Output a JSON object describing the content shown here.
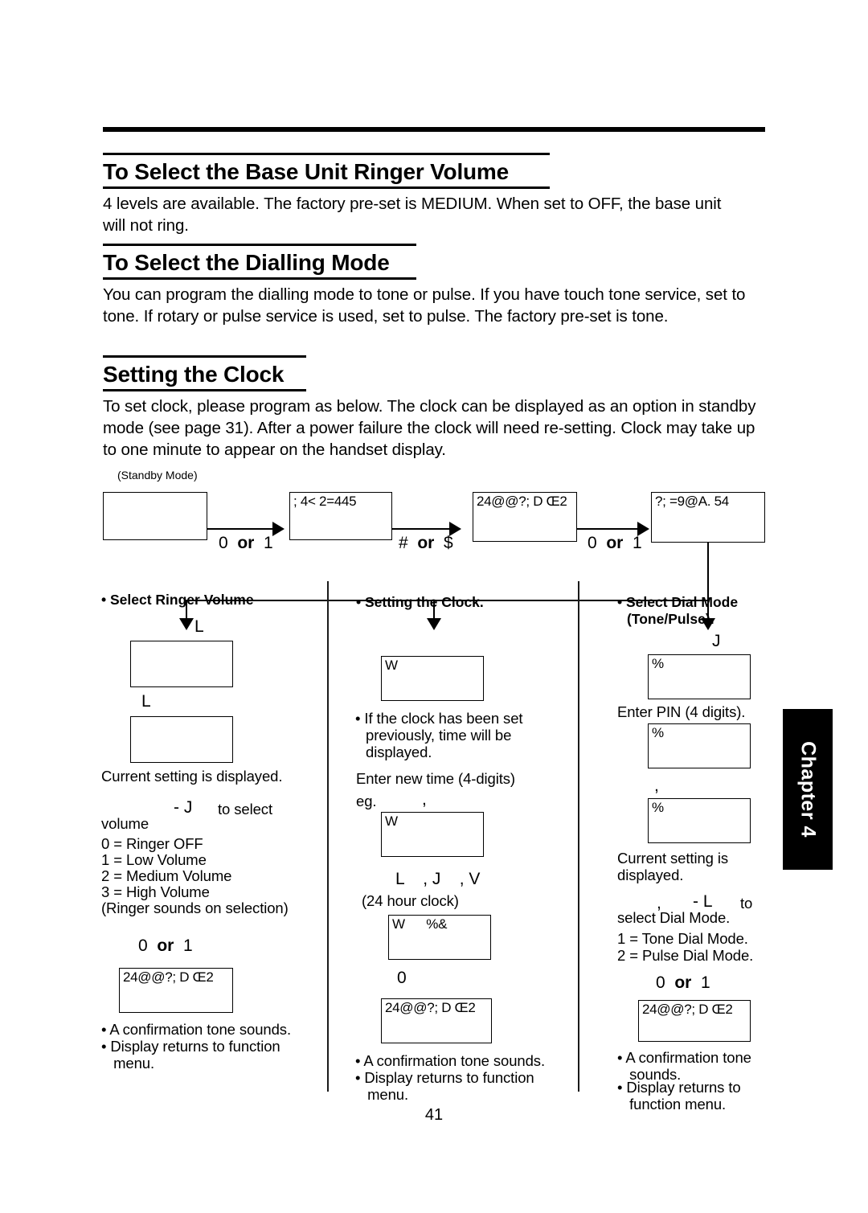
{
  "page": {
    "number": "41",
    "chapter_tab": "Chapter 4"
  },
  "sections": [
    {
      "heading": "To Select the Base Unit Ringer Volume",
      "body": "4 levels are available. The factory pre-set is MEDIUM. When set to OFF, the base unit will not ring."
    },
    {
      "heading": "To Select the Dialling Mode",
      "body": "You can program the dialling mode to tone or pulse. If you have touch tone service, set to tone. If rotary or pulse service is used, set to pulse. The factory pre-set is tone."
    },
    {
      "heading": "Setting the Clock",
      "body": "To set clock, please program as below. The clock can be displayed as an option in standby mode (see page 31). After a power failure the clock will need re-setting. Clock may take up to one minute to appear on the handset display."
    }
  ],
  "flow": {
    "standby_label": "(Standby Mode)",
    "steps": [
      {
        "display": ""
      },
      {
        "display": "; 4< 2=445"
      },
      {
        "display": "24@@?; D Œ2"
      },
      {
        "display": "?; =9@A. 54"
      }
    ],
    "key_labels": [
      {
        "first": "0",
        "or": "or",
        "second": "1"
      },
      {
        "first": "#",
        "or": "or",
        "second": "$"
      },
      {
        "first": "0",
        "or": "or",
        "second": "1"
      }
    ]
  },
  "columns": [
    {
      "title": "• Select Ringer Volume",
      "sym_above_box1": "L",
      "box1": "",
      "sym_above_box2": "L",
      "box2": "",
      "note1": "Current setting is displayed.",
      "sym_select": "- J",
      "select_text_right": "to select",
      "select_text_next": "volume",
      "options": [
        "0 = Ringer OFF",
        "1 = Low Volume",
        "2 = Medium Volume",
        "3 = High Volume",
        "(Ringer sounds on selection)"
      ],
      "key_label": {
        "first": "0",
        "or": "or",
        "second": "1"
      },
      "final_box": "24@@?; D Œ2",
      "bullets": [
        "• A confirmation tone sounds.",
        "• Display returns to function",
        "   menu."
      ]
    },
    {
      "title": "• Setting the Clock.",
      "box1": "W",
      "bullet1_line1": "• If the clock has been set",
      "bullet1_line2": "previously, time will be",
      "bullet1_line3": "displayed.",
      "enter_line": "Enter new time (4-digits)",
      "eg_label": "eg.",
      "eg_sym": ",",
      "box2": "W",
      "sym_row": "L    , J    , V",
      "clock_note": "(24 hour clock)",
      "box3": "W      %&",
      "key_label": {
        "first": "0",
        "or": "",
        "second": ""
      },
      "final_box": "24@@?; D Œ2",
      "bullets": [
        "• A confirmation tone sounds.",
        "• Display returns to function",
        "   menu."
      ]
    },
    {
      "title_line1": "• Select Dial Mode",
      "title_line2": "(Tone/Pulse).",
      "sym_above_box1": "J",
      "box1": "%",
      "note_pin": "Enter PIN (4 digits).",
      "box2": "%",
      "sym_above_box3": ",",
      "box3": "%",
      "note_current_line1": "Current setting is",
      "note_current_line2": "displayed.",
      "sym_select_left": ",",
      "sym_select": "- L",
      "select_text_right": "to",
      "select_text_next": "select Dial Mode.",
      "options": [
        "1 = Tone Dial Mode.",
        "2 = Pulse Dial Mode."
      ],
      "key_label": {
        "first": "0",
        "or": "or",
        "second": "1"
      },
      "final_box": "24@@?; D  Œ2",
      "bullets": [
        "• A confirmation tone",
        "   sounds.",
        "• Display returns to",
        "   function menu."
      ]
    }
  ]
}
